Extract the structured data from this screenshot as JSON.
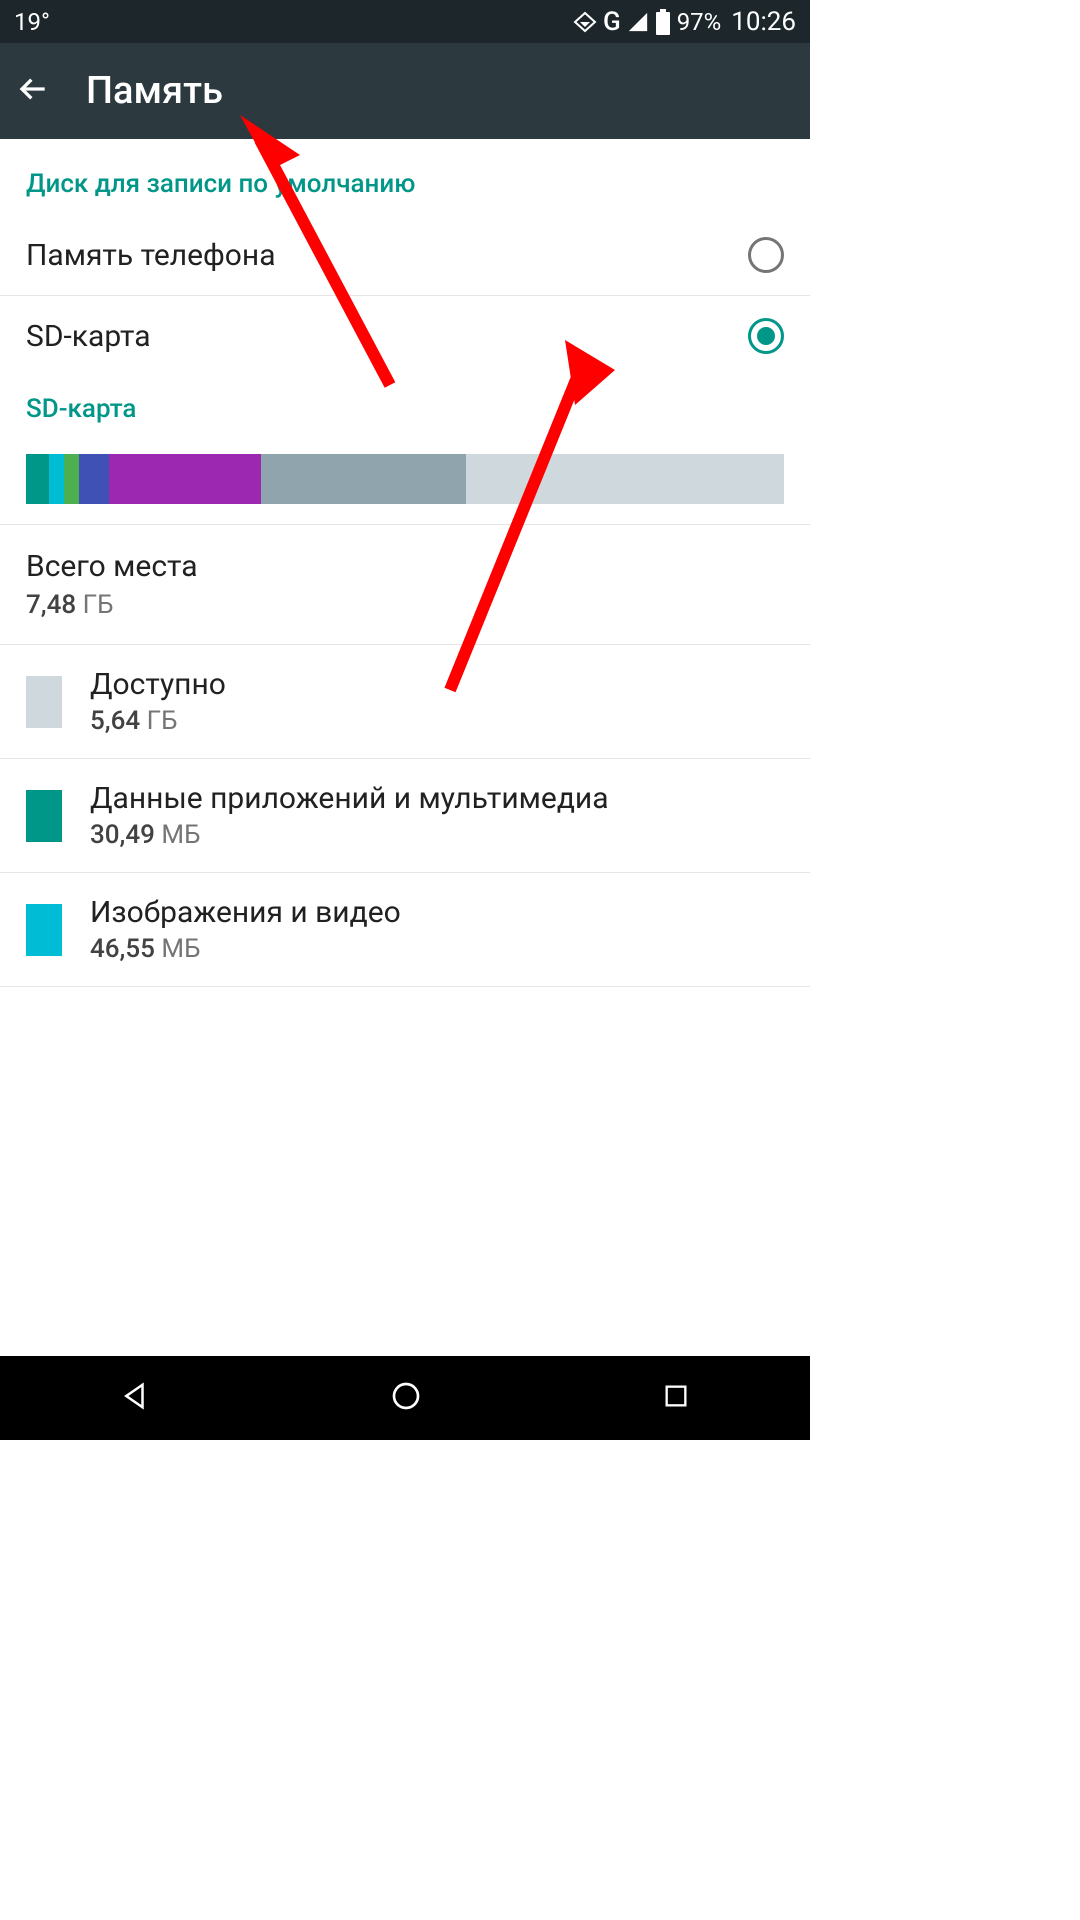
{
  "status": {
    "temperature": "19°",
    "battery_pct": "97%",
    "time": "10:26"
  },
  "header": {
    "title": "Память"
  },
  "default_disk": {
    "section_label": "Диск для записи по умолчанию",
    "options": [
      {
        "label": "Память телефона",
        "selected": false
      },
      {
        "label": "SD-карта",
        "selected": true
      }
    ]
  },
  "sd_card": {
    "section_label": "SD-карта",
    "segments": [
      {
        "color": "#009688",
        "pct": 3
      },
      {
        "color": "#00bcd4",
        "pct": 2
      },
      {
        "color": "#4caf50",
        "pct": 2
      },
      {
        "color": "#3f51b5",
        "pct": 4
      },
      {
        "color": "#9c27b0",
        "pct": 20
      },
      {
        "color": "#90a4ae",
        "pct": 27
      },
      {
        "color": "#cfd8dc",
        "pct": 42
      }
    ],
    "total": {
      "label": "Всего места",
      "value": "7,48",
      "unit": "ГБ"
    },
    "categories": [
      {
        "color": "#cfd8dc",
        "label": "Доступно",
        "value": "5,64",
        "unit": "ГБ"
      },
      {
        "color": "#009688",
        "label": "Данные приложений и мультимедиа",
        "value": "30,49",
        "unit": "МБ"
      },
      {
        "color": "#00bcd4",
        "label": "Изображения и видео",
        "value": "46,55",
        "unit": "МБ"
      }
    ]
  }
}
